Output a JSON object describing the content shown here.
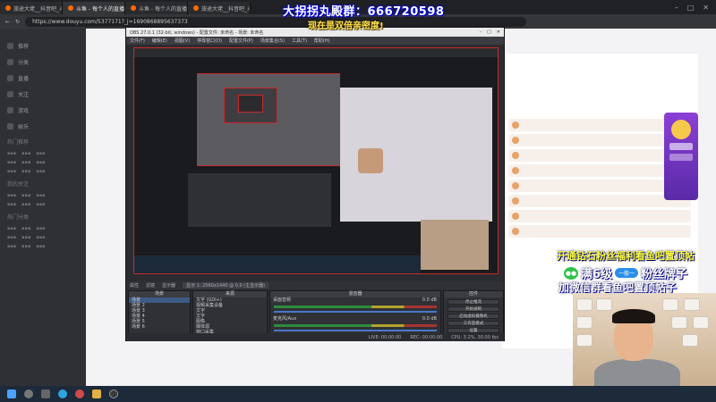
{
  "browser": {
    "tabs": [
      {
        "label": "旅途大佬__抖音吧_斗鱼吧"
      },
      {
        "label": "斗鱼 - 每个人的直播平台"
      },
      {
        "label": "斗鱼 - 每个人的直播平台"
      },
      {
        "label": "旅途大佬__抖音吧_斗鱼吧"
      }
    ],
    "url": "https://www.douyu.com/5377171?_j=1690868895637373"
  },
  "overlays": {
    "banner_qq": "大拐拐丸殿群：666720598",
    "banner_sub": "现在是双倍亲密度!",
    "promo_line1": "开通钻石粉丝福利看鱼吧置顶帖",
    "promo_line2_text": "满6级",
    "promo_badge": "一般一",
    "promo_line2_tail": "粉丝牌子",
    "promo_line3": "加微信群看鱼吧置顶帖子"
  },
  "obs": {
    "title": "OBS 27.0.1 (32-bit, windows) - 配置文件: 未命名 - 场景: 未命名",
    "menu": [
      "文件(F)",
      "编辑(E)",
      "视图(V)",
      "停靠窗口(D)",
      "配置文件(P)",
      "场景集合(S)",
      "工具(T)",
      "帮助(H)"
    ],
    "toolbar": [
      "属性",
      "滤镜",
      "显示器",
      "显示 1: 2560x1440 @ 0,0 (主显示器)"
    ],
    "scenes_header": "场景",
    "scenes": [
      "场景",
      "场景 2",
      "场景 3",
      "场景 4",
      "场景 5",
      "场景 6"
    ],
    "sources_header": "来源",
    "sources": [
      "文字 (GDI+)",
      "视频采集设备",
      "文字",
      "文字",
      "图像",
      "媒体源",
      "窗口采集",
      "显示器采集"
    ],
    "mixer_header": "混音器",
    "mixer": [
      {
        "label": "桌面音频",
        "db": "0.0 dB"
      },
      {
        "label": "麦克风/Aux",
        "db": "0.0 dB"
      }
    ],
    "controls_header": "控件",
    "controls": [
      "停止推流",
      "开始录制",
      "启动虚拟摄像机",
      "工作室模式",
      "设置",
      "退出"
    ],
    "status": [
      "LIVE: 00:00:00",
      "REC: 00:00:00",
      "CPU: 3.2%, 30.00 fps"
    ]
  },
  "page": {
    "nav_groups": [
      "热门推荐",
      "我的关注",
      "热门分类"
    ],
    "nav_items": [
      "推荐",
      "分类",
      "直播",
      "关注",
      "游戏",
      "娱乐"
    ]
  },
  "colors": {
    "obs_border": "#c92a2a",
    "banner_blue": "#0000ff",
    "promo_yellow": "#ffff3a",
    "wechat_green": "#2fc24a"
  }
}
